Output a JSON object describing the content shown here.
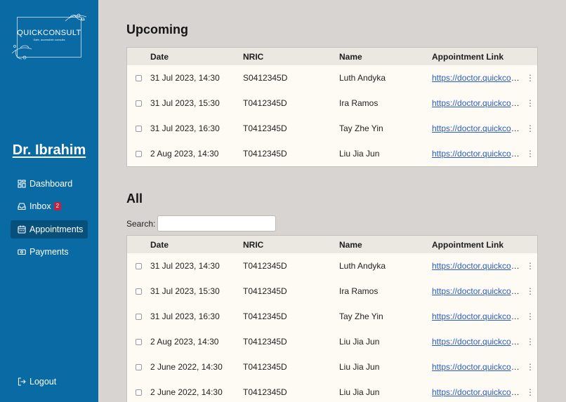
{
  "brand": {
    "name": "QUICKCONSULT",
    "tagline": "Safe, accessible consults"
  },
  "doctor": {
    "name": "Dr. Ibrahim"
  },
  "nav": {
    "items": [
      {
        "label": "Dashboard",
        "icon": "dashboard-icon"
      },
      {
        "label": "Inbox",
        "icon": "inbox-icon",
        "badge": "2"
      },
      {
        "label": "Appointments",
        "icon": "calendar-icon",
        "active": true
      },
      {
        "label": "Payments",
        "icon": "payment-icon"
      }
    ],
    "logout": "Logout"
  },
  "columns": {
    "date": "Date",
    "nric": "NRIC",
    "name": "Name",
    "link": "Appointment Link"
  },
  "upcoming": {
    "title": "Upcoming",
    "rows": [
      {
        "date": "31 Jul 2023, 14:30",
        "nric": "S0412345D",
        "name": "Luth Andyka",
        "link": "https://doctor.quickconsult"
      },
      {
        "date": "31 Jul 2023, 15:30",
        "nric": "T0412345D",
        "name": "Ira Ramos",
        "link": "https://doctor.quickconsult"
      },
      {
        "date": "31 Jul 2023, 16:30",
        "nric": "T0412345D",
        "name": "Tay Zhe Yin",
        "link": "https://doctor.quickconsult"
      },
      {
        "date": "2 Aug 2023, 14:30",
        "nric": "T0412345D",
        "name": "Liu Jia Jun",
        "link": "https://doctor.quickconsult"
      }
    ]
  },
  "all": {
    "title": "All",
    "search_label": "Search:",
    "search_value": "",
    "rows": [
      {
        "date": "31 Jul 2023, 14:30",
        "nric": "T0412345D",
        "name": "Luth Andyka",
        "link": "https://doctor.quickconsult"
      },
      {
        "date": "31 Jul 2023, 15:30",
        "nric": "T0412345D",
        "name": "Ira Ramos",
        "link": "https://doctor.quickconsult"
      },
      {
        "date": "31 Jul 2023, 16:30",
        "nric": "T0412345D",
        "name": "Tay Zhe Yin",
        "link": "https://doctor.quickconsult"
      },
      {
        "date": "2 Aug 2023, 14:30",
        "nric": "T0412345D",
        "name": "Liu Jia Jun",
        "link": "https://doctor.quickconsult"
      },
      {
        "date": "2 June 2022, 14:30",
        "nric": "T0412345D",
        "name": "Liu Jia Jun",
        "link": "https://doctor.quickconsult"
      },
      {
        "date": "2 June 2022, 14:30",
        "nric": "T0412345D",
        "name": "Liu Jia Jun",
        "link": "https://doctor.quickconsult"
      }
    ]
  },
  "colors": {
    "sidebar": "#0a6aa4",
    "sidebar_active": "#08507c",
    "background": "#d7d4d1",
    "table_bg": "#fdfbf3",
    "header_bg": "#ebe8e1",
    "link": "#2a5cc7",
    "badge": "#c0233d"
  }
}
